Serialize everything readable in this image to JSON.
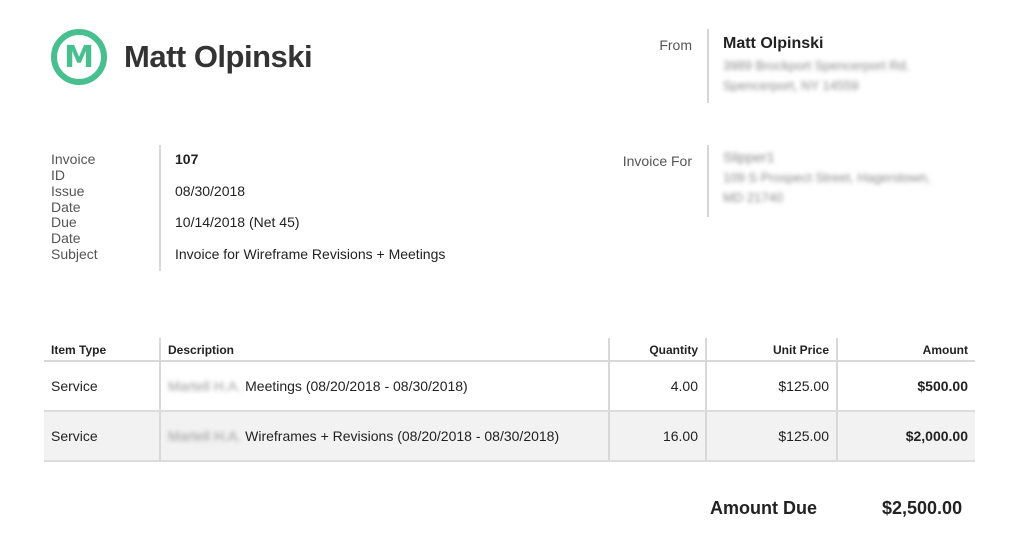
{
  "logo": {
    "initial": "M",
    "name": "Matt Olpinski"
  },
  "from": {
    "label": "From",
    "name": "Matt Olpinski",
    "address_line1": "3989 Brockport Spencerport Rd.",
    "address_line2": "Spencerport, NY 14559"
  },
  "meta": [
    {
      "label": "Invoice ID",
      "value": "107"
    },
    {
      "label": "Issue Date",
      "value": "08/30/2018"
    },
    {
      "label": "Due Date",
      "value": "10/14/2018 (Net 45)"
    },
    {
      "label": "Subject",
      "value": "Invoice for Wireframe Revisions + Meetings"
    }
  ],
  "invoice_for": {
    "label": "Invoice For",
    "name": "Slipper1",
    "address_line1": "109 S Prospect Street, Hagerstown,",
    "address_line2": "MD 21740"
  },
  "table": {
    "headers": {
      "item_type": "Item Type",
      "description": "Description",
      "quantity": "Quantity",
      "unit_price": "Unit Price",
      "amount": "Amount"
    },
    "rows": [
      {
        "item_type": "Service",
        "desc_prefix": "Martell H.A.",
        "description": "Meetings (08/20/2018 - 08/30/2018)",
        "quantity": "4.00",
        "unit_price": "$125.00",
        "amount": "$500.00"
      },
      {
        "item_type": "Service",
        "desc_prefix": "Martell H.A.",
        "description": "Wireframes + Revisions (08/20/2018 - 08/30/2018)",
        "quantity": "16.00",
        "unit_price": "$125.00",
        "amount": "$2,000.00"
      }
    ]
  },
  "total": {
    "label": "Amount Due",
    "value": "$2,500.00"
  }
}
